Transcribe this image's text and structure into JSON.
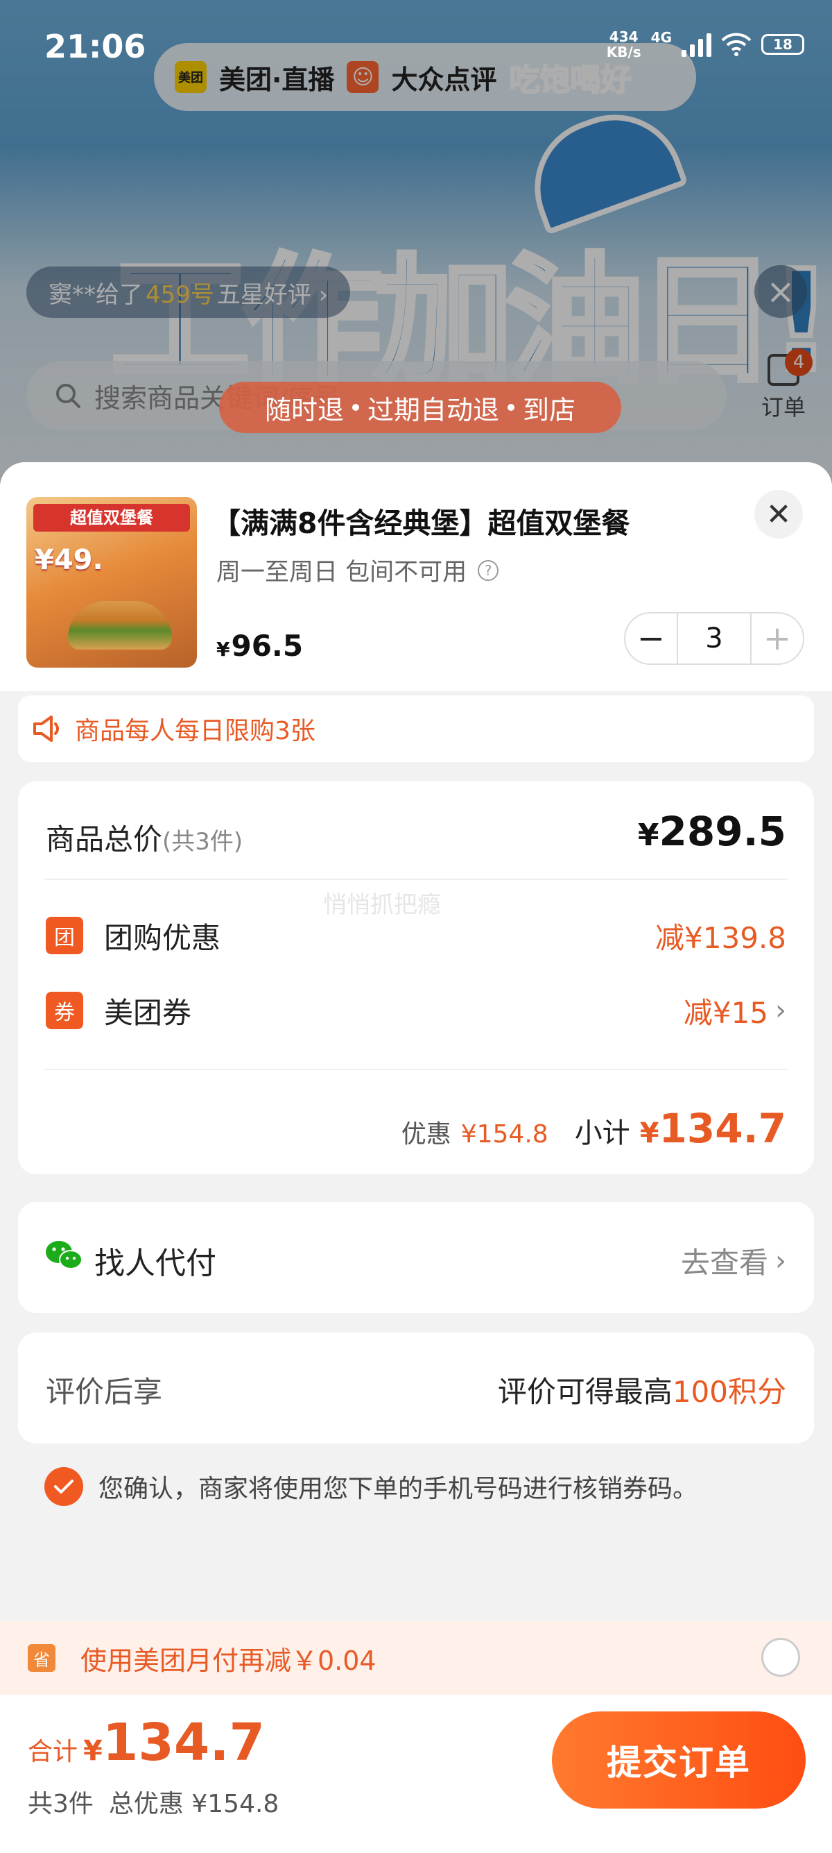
{
  "status_bar": {
    "time": "21:06",
    "net_speed_value": "434",
    "net_speed_unit": "KB/s",
    "network": "4G",
    "battery": "18"
  },
  "background": {
    "brand_1": "美团·直播",
    "brand_1_logo": "美团",
    "brand_2": "大众点评",
    "promo": "吃饱喝好",
    "banner_text": "工作加油日!",
    "review_ticker": {
      "prefix": "窦**给了",
      "highlight": "459号",
      "suffix": "五星好评 ›"
    },
    "search_placeholder": "搜索商品关键词/序号",
    "orders_label": "订单",
    "orders_badge": "4",
    "tags": [
      "随时退",
      "过期自动退",
      "到店"
    ]
  },
  "product": {
    "image_title": "超值双堡餐",
    "image_price": "¥49.",
    "title": "【满满8件含经典堡】超值双堡餐",
    "subtitle": "周一至周日 包间不可用",
    "currency": "¥",
    "price": "96.5",
    "quantity": "3"
  },
  "limit_notice": "商品每人每日限购3张",
  "price_card": {
    "total_label": "商品总价",
    "total_count": "(共3件)",
    "total_currency": "¥",
    "total_value": "289.5",
    "watermark": "悄悄抓把瘾",
    "discounts": [
      {
        "badge": "团",
        "label": "团购优惠",
        "value": "减¥139.8"
      },
      {
        "badge": "券",
        "label": "美团券",
        "value": "减¥15"
      }
    ],
    "saving_label": "优惠",
    "saving_value": "¥154.8",
    "subtotal_label": "小计",
    "subtotal_currency": "¥",
    "subtotal_value": "134.7"
  },
  "pay_for_me": {
    "label": "找人代付",
    "link": "去查看"
  },
  "rating": {
    "label": "评价后享",
    "value_prefix": "评价可得最高",
    "value_highlight": "100积分"
  },
  "confirm_text": "您确认，商家将使用您下单的手机号码进行核销券码。",
  "promo": {
    "icon": "省",
    "text": "使用美团月付再减￥0.04"
  },
  "bottom_bar": {
    "total_label": "合计",
    "currency": "¥",
    "total_value": "134.7",
    "count": "共3件",
    "total_discount": "总优惠 ¥154.8",
    "submit": "提交订单"
  },
  "colors": {
    "accent": "#f05a22",
    "accent_text": "#e85a24",
    "wechat": "#1aad19"
  }
}
